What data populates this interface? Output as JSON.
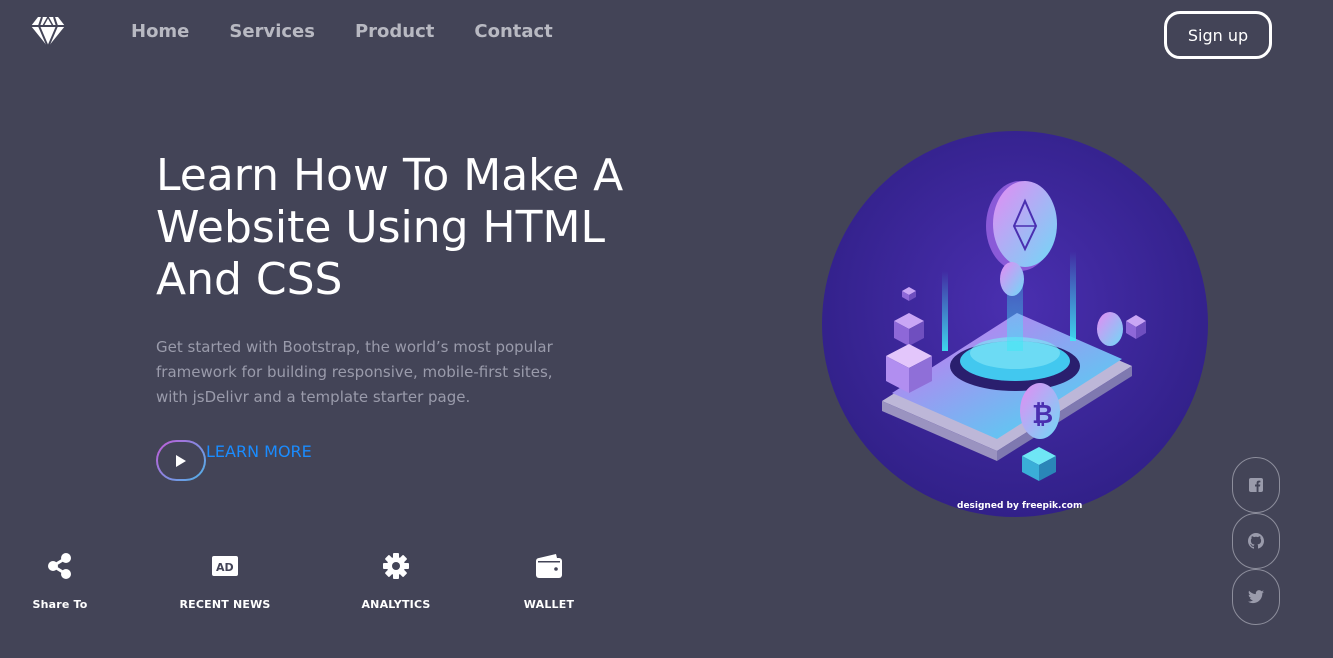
{
  "nav": {
    "logo_icon": "diamond-icon",
    "links": [
      "Home",
      "Services",
      "Product",
      "Contact"
    ],
    "signup_label": "Sign up"
  },
  "hero": {
    "title": "Learn How To Make A Website Using HTML And CSS",
    "text": "Get started with Bootstrap, the world’s most popular framework for building responsive, mobile-first sites, with jsDelivr and a template starter page.",
    "cta_icon": "play-icon",
    "cta_label": "LEARN MORE",
    "image_credit": "designed by freepik.com"
  },
  "features": [
    {
      "icon": "share-icon",
      "label": "Share To"
    },
    {
      "icon": "ad-icon",
      "label": "RECENT NEWS"
    },
    {
      "icon": "gear-icon",
      "label": "ANALYTICS"
    },
    {
      "icon": "wallet-icon",
      "label": "WALLET"
    }
  ],
  "social": [
    "facebook-icon",
    "github-icon",
    "twitter-icon"
  ],
  "colors": {
    "background": "#434457",
    "nav_link": "#b8b9c2",
    "link_blue": "#1a8cff",
    "muted_text": "#9a9bab",
    "circle_purple": "#3a2a8f",
    "cyan": "#3ee8f5"
  }
}
